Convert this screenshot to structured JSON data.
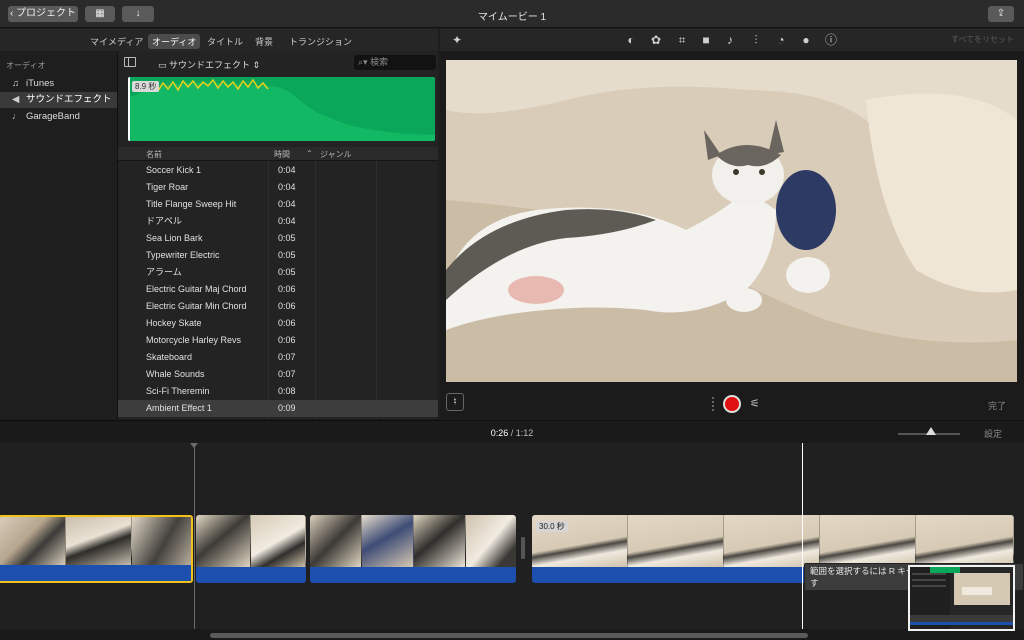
{
  "titlebar": {
    "back_label": "プロジェクト",
    "title": "マイムービー 1"
  },
  "browser_tabs": [
    {
      "label": "マイメディア",
      "active": false
    },
    {
      "label": "オーディオ",
      "active": true
    },
    {
      "label": "タイトル",
      "active": false
    },
    {
      "label": "背景",
      "active": false
    },
    {
      "label": "トランジション",
      "active": false
    }
  ],
  "viewer_tools": {
    "icons": [
      "magic-wand-icon",
      "color-balance-icon",
      "color-correction-icon",
      "crop-icon",
      "stabilization-icon",
      "volume-icon",
      "noise-reduction-icon",
      "speed-icon",
      "clip-filter-icon",
      "info-icon"
    ],
    "reset_all_label": "すべてをリセット"
  },
  "sidebar": {
    "heading": "オーディオ",
    "items": [
      {
        "label": "iTunes",
        "icon": "music-note-icon",
        "selected": false
      },
      {
        "label": "サウンドエフェクト",
        "icon": "speaker-icon",
        "selected": true
      },
      {
        "label": "GarageBand",
        "icon": "guitar-icon",
        "selected": false
      }
    ]
  },
  "library": {
    "popup_label": "サウンドエフェクト",
    "search_placeholder": "検索",
    "waveform_duration": "8.9 秒",
    "columns": {
      "name": "名前",
      "time": "時間",
      "genre": "ジャンル"
    },
    "rows": [
      {
        "name": "Soccer Kick 1",
        "time": "0:04"
      },
      {
        "name": "Tiger Roar",
        "time": "0:04"
      },
      {
        "name": "Title Flange Sweep Hit",
        "time": "0:04"
      },
      {
        "name": "ドアベル",
        "time": "0:04"
      },
      {
        "name": "Sea Lion Bark",
        "time": "0:05"
      },
      {
        "name": "Typewriter Electric",
        "time": "0:05"
      },
      {
        "name": "アラーム",
        "time": "0:05"
      },
      {
        "name": "Electric Guitar Maj Chord",
        "time": "0:06"
      },
      {
        "name": "Electric Guitar Min Chord",
        "time": "0:06"
      },
      {
        "name": "Hockey Skate",
        "time": "0:06"
      },
      {
        "name": "Motorcycle Harley Revs",
        "time": "0:06"
      },
      {
        "name": "Skateboard",
        "time": "0:07"
      },
      {
        "name": "Whale Sounds",
        "time": "0:07"
      },
      {
        "name": "Sci-Fi Theremin",
        "time": "0:08"
      },
      {
        "name": "Ambient Effect 1",
        "time": "0:09",
        "selected": true
      }
    ]
  },
  "viewer": {
    "done_label": "完了"
  },
  "timeline": {
    "current_time": "0:26",
    "separator": "/",
    "total_time": "1:12",
    "settings_label": "設定",
    "clip_duration": "30.0 秒",
    "tooltip": "範囲を選択するには R キーを押しながらドラッグします"
  },
  "colors": {
    "waveform_green": "#0aa75a",
    "waveform_highlight": "#e8d21d",
    "selection_yellow": "#f1c21b",
    "audio_blue": "#1d4fae",
    "record_red": "#e01010"
  }
}
